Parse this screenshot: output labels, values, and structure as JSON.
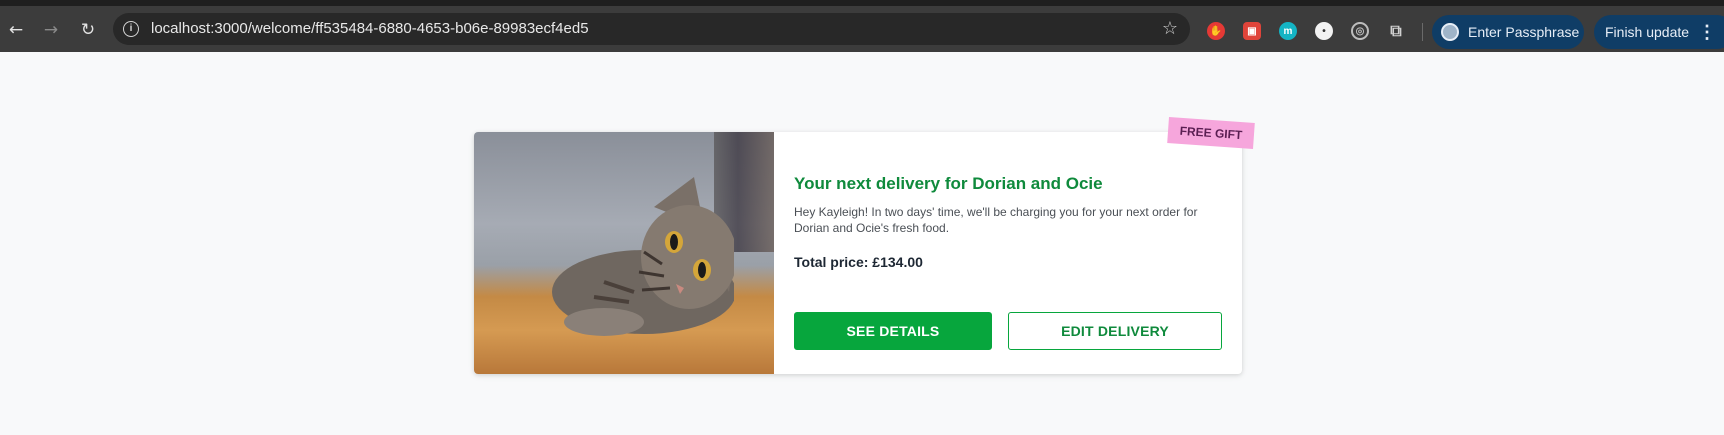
{
  "browser": {
    "url": "localhost:3000/welcome/ff535484-6880-4653-b06e-89983ecf4ed5",
    "profile_label": "Enter Passphrase",
    "update_label": "Finish update",
    "icons": {
      "back": "back-arrow-icon",
      "forward": "forward-arrow-icon",
      "reload": "reload-icon",
      "site_info": "site-info-icon",
      "bookmark": "star-icon",
      "extensions": "puzzle-icon",
      "menu": "more-vert-icon"
    },
    "extensions": [
      {
        "name": "red-hand-extension-icon",
        "color": "#e53935"
      },
      {
        "name": "red-box-extension-icon",
        "color": "#e0443a"
      },
      {
        "name": "m-extension-icon",
        "color": "#14b4c4",
        "glyph": "m"
      },
      {
        "name": "white-circle-extension-icon",
        "color": "#f2f2f2"
      },
      {
        "name": "target-extension-icon",
        "color": "#bdbdbd"
      }
    ]
  },
  "card": {
    "sticker": "FREE GIFT",
    "title": "Your next delivery for Dorian and Ocie",
    "description": "Hey Kayleigh! In two days' time, we'll be charging you for your next order for Dorian and Ocie's fresh food.",
    "price": "Total price: £134.00",
    "primary_button": "SEE DETAILS",
    "secondary_button": "EDIT DELIVERY",
    "colors": {
      "accent_green": "#07a63d",
      "title_green": "#0f8a3c",
      "sticker_pink": "#f6a6dc"
    }
  }
}
